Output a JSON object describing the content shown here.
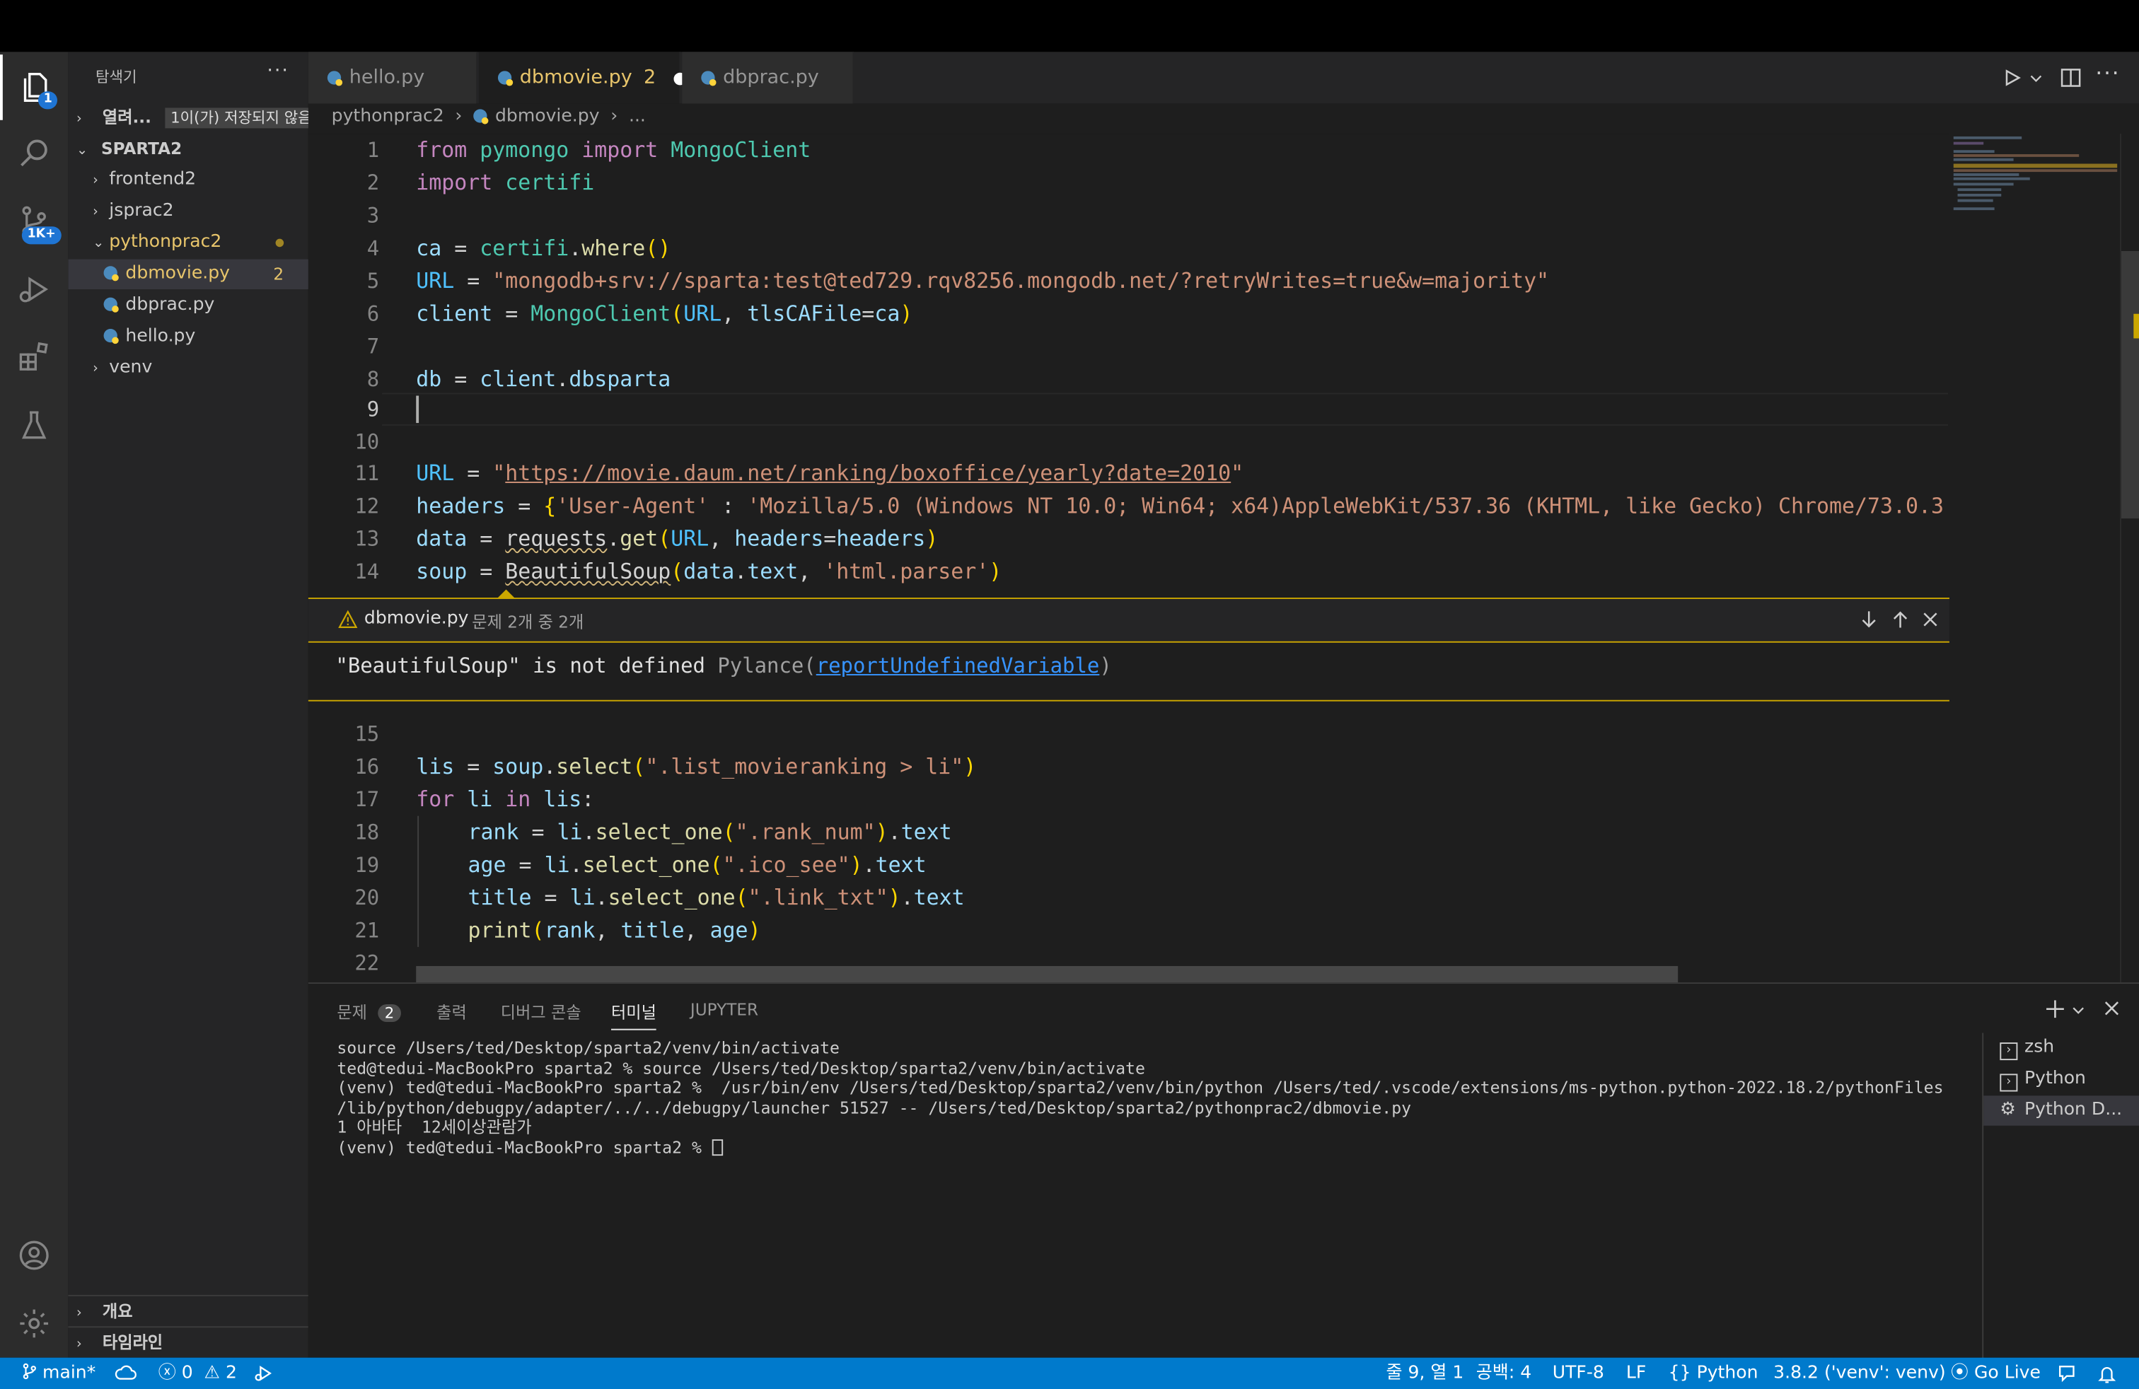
{
  "activity": {
    "explorer_badge": "1",
    "scm_badge": "1K+"
  },
  "sidebar": {
    "title": "탐색기",
    "more": "···",
    "open_editors_label": "열려...",
    "open_editors_badge": "1이(가) 저장되지 않음",
    "workspace": "SPARTA2",
    "tree": [
      {
        "label": "frontend2",
        "type": "folder"
      },
      {
        "label": "jsprac2",
        "type": "folder"
      },
      {
        "label": "pythonprac2",
        "type": "folder-open"
      },
      {
        "label": "dbmovie.py",
        "type": "file",
        "badge": "2"
      },
      {
        "label": "dbprac.py",
        "type": "file"
      },
      {
        "label": "hello.py",
        "type": "file"
      },
      {
        "label": "venv",
        "type": "folder"
      }
    ],
    "outline": "개요",
    "timeline": "타임라인"
  },
  "tabs": [
    {
      "label": "hello.py"
    },
    {
      "label": "dbmovie.py",
      "count": "2",
      "dirty": "●"
    },
    {
      "label": "dbprac.py"
    }
  ],
  "breadcrumb": {
    "folder": "pythonprac2",
    "file": "dbmovie.py",
    "tail": "..."
  },
  "editor": {
    "lines_top": [
      "1",
      "2",
      "3",
      "4",
      "5",
      "6",
      "7",
      "8",
      "9",
      "10",
      "11",
      "12",
      "13",
      "14"
    ],
    "lines_bottom": [
      "15",
      "16",
      "17",
      "18",
      "19",
      "20",
      "21",
      "22"
    ],
    "code": {
      "l1": [
        "from",
        "pymongo",
        "import",
        "MongoClient"
      ],
      "l2": [
        "import",
        "certifi"
      ],
      "l4": [
        "ca",
        "=",
        "certifi",
        ".",
        "where",
        "()"
      ],
      "l5": [
        "URL",
        "=",
        "\"mongodb+srv://sparta:test@ted729.rqv8256.mongodb.net/?retryWrites=true&w=majority\""
      ],
      "l6": [
        "client",
        "=",
        "MongoClient",
        "(",
        "URL",
        ", ",
        "tlsCAFile",
        "=",
        "ca",
        ")"
      ],
      "l8": [
        "db",
        "=",
        "client",
        ".",
        "dbsparta"
      ],
      "l11": [
        "URL",
        "=",
        "\"",
        "https://movie.daum.net/ranking/boxoffice/yearly?date=2010",
        "\""
      ],
      "l12": [
        "headers",
        "=",
        "{",
        "'User-Agent'",
        " : ",
        "'Mozilla/5.0 (Windows NT 10.0; Win64; x64)AppleWebKit/537.36 (KHTML, like Gecko) Chrome/73.0.3"
      ],
      "l13": [
        "data",
        "=",
        "requests",
        ".",
        "get",
        "(",
        "URL",
        ", ",
        "headers",
        "=",
        "headers",
        ")"
      ],
      "l14": [
        "soup",
        "=",
        "BeautifulSoup",
        "(",
        "data",
        ".",
        "text",
        ", ",
        "'html.parser'",
        ")"
      ],
      "l16": [
        "lis",
        "=",
        "soup",
        ".",
        "select",
        "(",
        "\".list_movieranking > li\"",
        ")"
      ],
      "l17": [
        "for",
        "li",
        "in",
        "lis",
        ":"
      ],
      "l18": [
        "rank",
        "=",
        "li",
        ".",
        "select_one",
        "(",
        "\".rank_num\"",
        ")",
        ".",
        "text"
      ],
      "l19": [
        "age",
        "=",
        "li",
        ".",
        "select_one",
        "(",
        "\".ico_see\"",
        ")",
        ".",
        "text"
      ],
      "l20": [
        "title",
        "=",
        "li",
        ".",
        "select_one",
        "(",
        "\".link_txt\"",
        ")",
        ".",
        "text"
      ],
      "l21": [
        "print",
        "(",
        "rank",
        ", ",
        "title",
        ", ",
        "age",
        ")"
      ]
    }
  },
  "peek": {
    "file": "dbmovie.py",
    "count": "문제 2개 중 2개",
    "message": "\"BeautifulSoup\" is not defined",
    "source": "Pylance(",
    "rule": "reportUndefinedVariable",
    "close_paren": ")"
  },
  "panel": {
    "tabs": [
      "문제",
      "출력",
      "디버그 콘솔",
      "터미널",
      "JUPYTER"
    ],
    "problems_count": "2",
    "terminal": [
      "source /Users/ted/Desktop/sparta2/venv/bin/activate",
      "ted@tedui-MacBookPro sparta2 % source /Users/ted/Desktop/sparta2/venv/bin/activate",
      "(venv) ted@tedui-MacBookPro sparta2 %  /usr/bin/env /Users/ted/Desktop/sparta2/venv/bin/python /Users/ted/.vscode/extensions/ms-python.python-2022.18.2/pythonFiles",
      "/lib/python/debugpy/adapter/../../debugpy/launcher 51527 -- /Users/ted/Desktop/sparta2/pythonprac2/dbmovie.py",
      "1 아바타  12세이상관람가",
      "(venv) ted@tedui-MacBookPro sparta2 % "
    ],
    "terminal_list": [
      "zsh",
      "Python",
      "Python D..."
    ]
  },
  "status": {
    "branch": "main*",
    "errors": "0",
    "warnings": "2",
    "position": "줄 9, 열 1",
    "spaces": "공백: 4",
    "encoding": "UTF-8",
    "eol": "LF",
    "language": "Python",
    "interpreter": "3.8.2 ('venv': venv)",
    "golive": "Go Live"
  },
  "colors": {
    "accent": "#007acc",
    "warning": "#cca700",
    "tab_active": "#e8c56b"
  }
}
